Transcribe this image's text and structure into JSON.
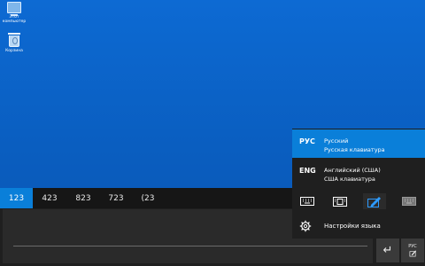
{
  "desktop": {
    "icons": [
      {
        "label": "Этот компьютер",
        "icon": "this-pc-icon"
      },
      {
        "label": "Корзина",
        "icon": "recycle-bin-icon"
      }
    ]
  },
  "keyboard": {
    "suggestions": [
      "123",
      "423",
      "823",
      "723",
      "(23"
    ],
    "selected_suggestion": "123",
    "enter_symbol": "↵",
    "lang_key_label": "РУС"
  },
  "language_flyout": {
    "languages": [
      {
        "code": "РУС",
        "name": "Русский",
        "layout": "Русская клавиатура"
      },
      {
        "code": "ENG",
        "name": "Английский (США)",
        "layout": "США клавиатура"
      }
    ],
    "keyboard_layouts": [
      "standard-keyboard-icon",
      "wide-keyboard-icon",
      "handwriting-pen-icon",
      "hardware-keyboard-icon"
    ],
    "selected_layout": "handwriting-pen-icon",
    "settings_label": "Настройки языка"
  },
  "colors": {
    "accent": "#0a7fd9",
    "desktop": "#0b63c7",
    "keyboard_bg": "#1f1f1f"
  }
}
